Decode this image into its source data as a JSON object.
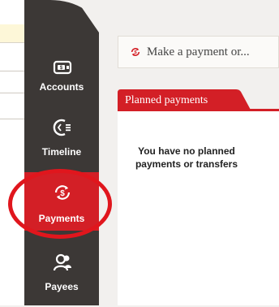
{
  "nav": {
    "items": [
      {
        "label": "Accounts",
        "icon": "wallet-icon"
      },
      {
        "label": "Timeline",
        "icon": "timeline-icon"
      },
      {
        "label": "Payments",
        "icon": "payments-icon",
        "active": true
      },
      {
        "label": "Payees",
        "icon": "payees-icon"
      }
    ]
  },
  "main": {
    "make_payment_label": "Make a payment or...",
    "tab_label": "Planned payments",
    "empty_message": "You have no planned payments or transfers"
  },
  "colors": {
    "accent": "#d31f26",
    "rail": "#3c3836",
    "highlight": "#e0161d"
  }
}
